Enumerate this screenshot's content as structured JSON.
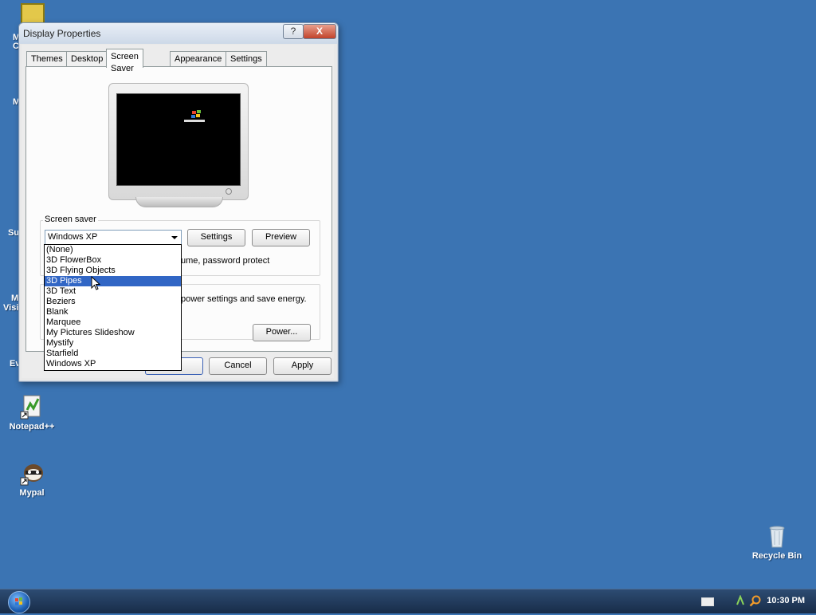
{
  "window": {
    "title": "Display Properties",
    "help_label": "?",
    "close_label": "X"
  },
  "tabs": [
    {
      "label": "Themes"
    },
    {
      "label": "Desktop"
    },
    {
      "label": "Screen Saver"
    },
    {
      "label": "Appearance"
    },
    {
      "label": "Settings"
    }
  ],
  "screen_saver": {
    "group_label": "Screen saver",
    "selected": "Windows XP",
    "settings_label": "Settings",
    "preview_label": "Preview",
    "resume_text": "ume, password protect",
    "power_text": "power settings and save energy.",
    "power_button": "Power...",
    "options": [
      "(None)",
      "3D FlowerBox",
      "3D Flying Objects",
      "3D Pipes",
      "3D Text",
      "Beziers",
      "Blank",
      "Marquee",
      "My Pictures Slideshow",
      "Mystify",
      "Starfield",
      "Windows XP"
    ],
    "highlighted": "3D Pipes"
  },
  "footer": {
    "ok_label": "",
    "cancel_label": "Cancel",
    "apply_label": "Apply"
  },
  "desktop": {
    "icons": [
      {
        "label": "Notepad++"
      },
      {
        "label": "Mypal"
      },
      {
        "label": "Recycle Bin"
      }
    ],
    "partial_labels": [
      "M",
      "C",
      "M",
      "Su",
      "M",
      "Visi",
      "Ev"
    ]
  },
  "taskbar": {
    "time": "10:30 PM"
  },
  "colors": {
    "desktop_bg": "#3b74b3",
    "selection": "#3166c5"
  }
}
